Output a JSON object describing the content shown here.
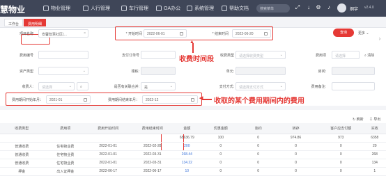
{
  "app": {
    "brand": "慧物业",
    "search_placeholder": "搜索菜单",
    "user": "炯宇",
    "version": "v2.4.0"
  },
  "nav": [
    {
      "label": "物业管理",
      "icon": "building-icon"
    },
    {
      "label": "人行管理",
      "icon": "person-icon"
    },
    {
      "label": "车行管理",
      "icon": "car-icon"
    },
    {
      "label": "OA办公",
      "icon": "oa-icon"
    },
    {
      "label": "系统管理",
      "icon": "gear-icon"
    },
    {
      "label": "帮助文档",
      "icon": "help-icon"
    }
  ],
  "tabs": [
    {
      "label": "工作台"
    },
    {
      "label": "费用明细"
    }
  ],
  "filters": {
    "project_label": "项目名称",
    "project_value": "安馨智慧社区(...",
    "start_label": "* 开始时间",
    "start_value": "2022-06-01",
    "end_label": "* 结束时间",
    "end_value": "2022-06-20",
    "fee_no_label": "费用编号",
    "pay_order_label": "支付订单号",
    "fee_type_label": "收费类型",
    "fee_type_placeholder": "请选择收费类型",
    "fee_item_label": "费用项",
    "fee_item_placeholder": "请选择",
    "asset_type_label": "资产类型",
    "building_label": "楼栋:",
    "unit_label": "单元:",
    "room_label": "房间:",
    "payer_label": "收费人:",
    "payer_placeholder": "请选择",
    "pos_label": "是否有关联合并:",
    "pos_value": "是",
    "pay_method_label": "支付方式:",
    "pay_method_placeholder": "请选择支付方式",
    "remark_label": "费用备注:",
    "period_start_label": "费用期间开始年月：",
    "period_start_value": "2021-01",
    "period_end_label": "费用期间结束年月：",
    "period_end_value": "2022-12"
  },
  "buttons": {
    "query": "查询",
    "more": "更多",
    "reset": "清除",
    "refresh": "刷新",
    "export": "导出"
  },
  "annotations": {
    "time_range": "收费时间段",
    "period": "收取的某个费用期间内的费用"
  },
  "table": {
    "headers": [
      "收费类型",
      "费用项",
      "费用开始时间",
      "费用结束时间",
      "金额",
      "优惠金额",
      "违约",
      "转存",
      "客户应支付额",
      "实收"
    ],
    "summary": [
      "",
      "",
      "",
      "",
      "65636.79",
      "100",
      "0",
      "974.86",
      "973",
      "6358"
    ],
    "rows": [
      [
        "普通收费",
        "住宅物业费",
        "2022-01-01",
        "2022-02-28",
        "200",
        "0",
        "0",
        "0",
        "0",
        "20"
      ],
      [
        "普通收费",
        "住宅物业费",
        "2022-01-01",
        "2022-03-31",
        "268.44",
        "0",
        "0",
        "0",
        "0",
        "268"
      ],
      [
        "普通收费",
        "住宅物业费",
        "2022-01-01",
        "2022-03-31",
        "134.22",
        "0",
        "0",
        "0",
        "0",
        "134"
      ],
      [
        "押金",
        "出入证押金",
        "2022-06-17",
        "2022-06-17",
        "10",
        "0",
        "0",
        "0",
        "0",
        "1"
      ]
    ]
  },
  "colors": {
    "accent": "#e53935",
    "topbar": "#3f4658",
    "link": "#3b73d9"
  }
}
